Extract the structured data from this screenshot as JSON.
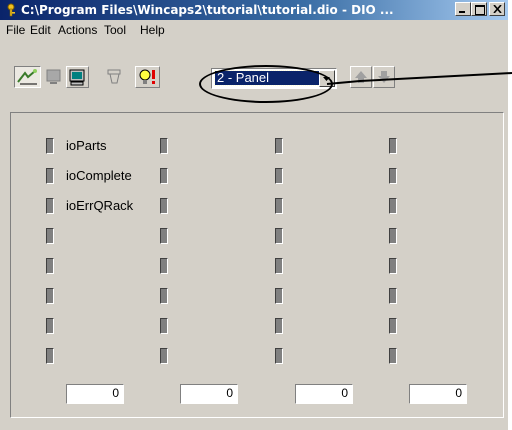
{
  "window": {
    "title": "C:\\Program Files\\Wincaps2\\tutorial\\tutorial.dio - DIO ..."
  },
  "menu": {
    "items": [
      "File",
      "Edit",
      "Actions",
      "Tool",
      "Help"
    ]
  },
  "toolbar": {
    "tools": [
      {
        "name": "monitor-io-icon",
        "state": "pressed"
      },
      {
        "name": "panel-view-icon",
        "state": "disabled"
      },
      {
        "name": "computer-icon",
        "state": "raised"
      },
      {
        "name": "clear-icon",
        "state": "disabled"
      },
      {
        "name": "alarm-bulb-icon",
        "state": "raised"
      }
    ],
    "panel_select": {
      "value": "2 - Panel"
    }
  },
  "panel": {
    "columns": [
      {
        "labels": [
          "ioParts",
          "ioComplete",
          "ioErrQRack",
          "",
          "",
          "",
          "",
          ""
        ],
        "value": "0"
      },
      {
        "labels": [
          "",
          "",
          "",
          "",
          "",
          "",
          "",
          ""
        ],
        "value": "0"
      },
      {
        "labels": [
          "",
          "",
          "",
          "",
          "",
          "",
          "",
          ""
        ],
        "value": "0"
      },
      {
        "labels": [
          "",
          "",
          "",
          "",
          "",
          "",
          "",
          ""
        ],
        "value": "0"
      }
    ]
  },
  "colors": {
    "titlebar": "#0a246a",
    "face": "#d4d0c8",
    "led_off": "#808080",
    "highlight": "#0a246a"
  }
}
